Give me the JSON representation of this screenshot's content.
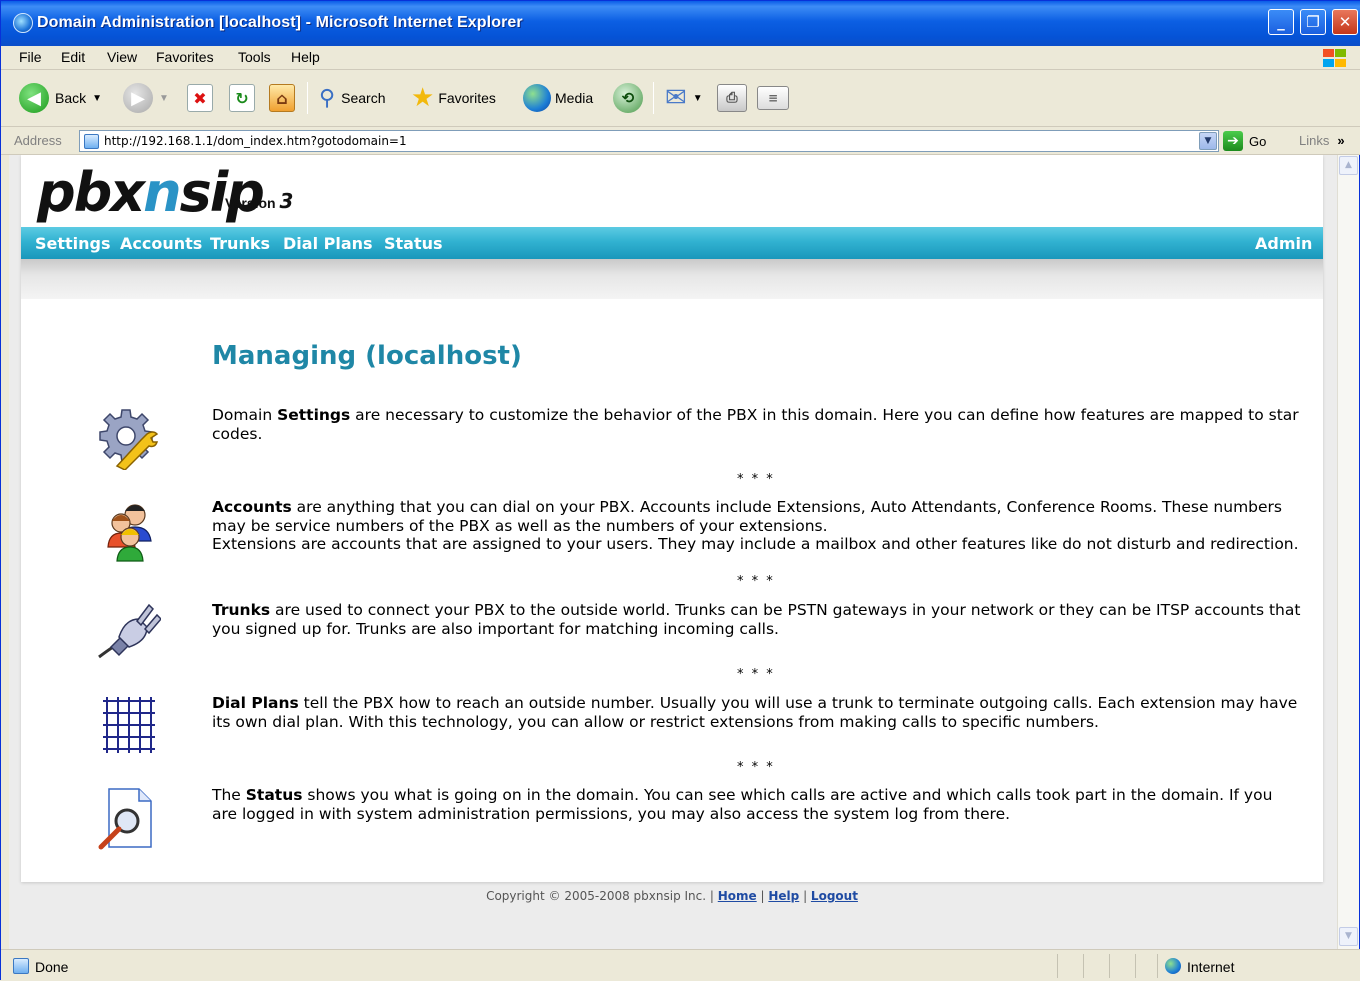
{
  "window": {
    "title": "Domain Administration [localhost] - Microsoft Internet Explorer"
  },
  "menu": [
    "File",
    "Edit",
    "View",
    "Favorites",
    "Tools",
    "Help"
  ],
  "toolbar": {
    "back": "Back",
    "search": "Search",
    "favorites": "Favorites",
    "media": "Media"
  },
  "address": {
    "label": "Address",
    "url": "http://192.168.1.1/dom_index.htm?gotodomain=1",
    "go": "Go",
    "links": "Links"
  },
  "app": {
    "brand_a": "pbx",
    "brand_b": "n",
    "brand_c": "sip",
    "version_label": "Version",
    "version_num": "3",
    "nav": [
      "Settings",
      "Accounts",
      "Trunks",
      "Dial Plans",
      "Status"
    ],
    "admin": "Admin"
  },
  "content": {
    "heading": "Managing (localhost)",
    "stars": "* * *",
    "settings": {
      "pre": "Domain ",
      "term": "Settings",
      "post": " are necessary to customize the behavior of the PBX in this domain. Here you can define how features are mapped to star codes."
    },
    "accounts": {
      "term": "Accounts",
      "post": " are anything that you can dial on your PBX. Accounts include Extensions, Auto Attendants, Conference Rooms. These numbers may be service numbers of the PBX as well as the numbers of your extensions.",
      "line2": "Extensions are accounts that are assigned to your users. They may include a mailbox and other features like do not disturb and redirection."
    },
    "trunks": {
      "term": "Trunks",
      "post": " are used to connect your PBX to the outside world. Trunks can be PSTN gateways in your network or they can be ITSP accounts that you signed up for. Trunks are also important for matching incoming calls."
    },
    "dialplans": {
      "term": "Dial Plans",
      "post": " tell the PBX how to reach an outside number. Usually you will use a trunk to terminate outgoing calls. Each extension may have its own dial plan. With this technology, you can allow or restrict extensions from making calls to specific numbers."
    },
    "status": {
      "pre": "The ",
      "term": "Status",
      "post": " shows you what is going on in the domain. You can see which calls are active and which calls took part in the domain. If you are logged in with system administration permissions, you may also access the system log from there."
    }
  },
  "footer": {
    "copyright": "Copyright © 2005-2008 pbxnsip Inc. | ",
    "sep": " | ",
    "home": "Home",
    "help": "Help",
    "logout": "Logout"
  },
  "statusbar": {
    "text": "Done",
    "zone": "Internet"
  }
}
